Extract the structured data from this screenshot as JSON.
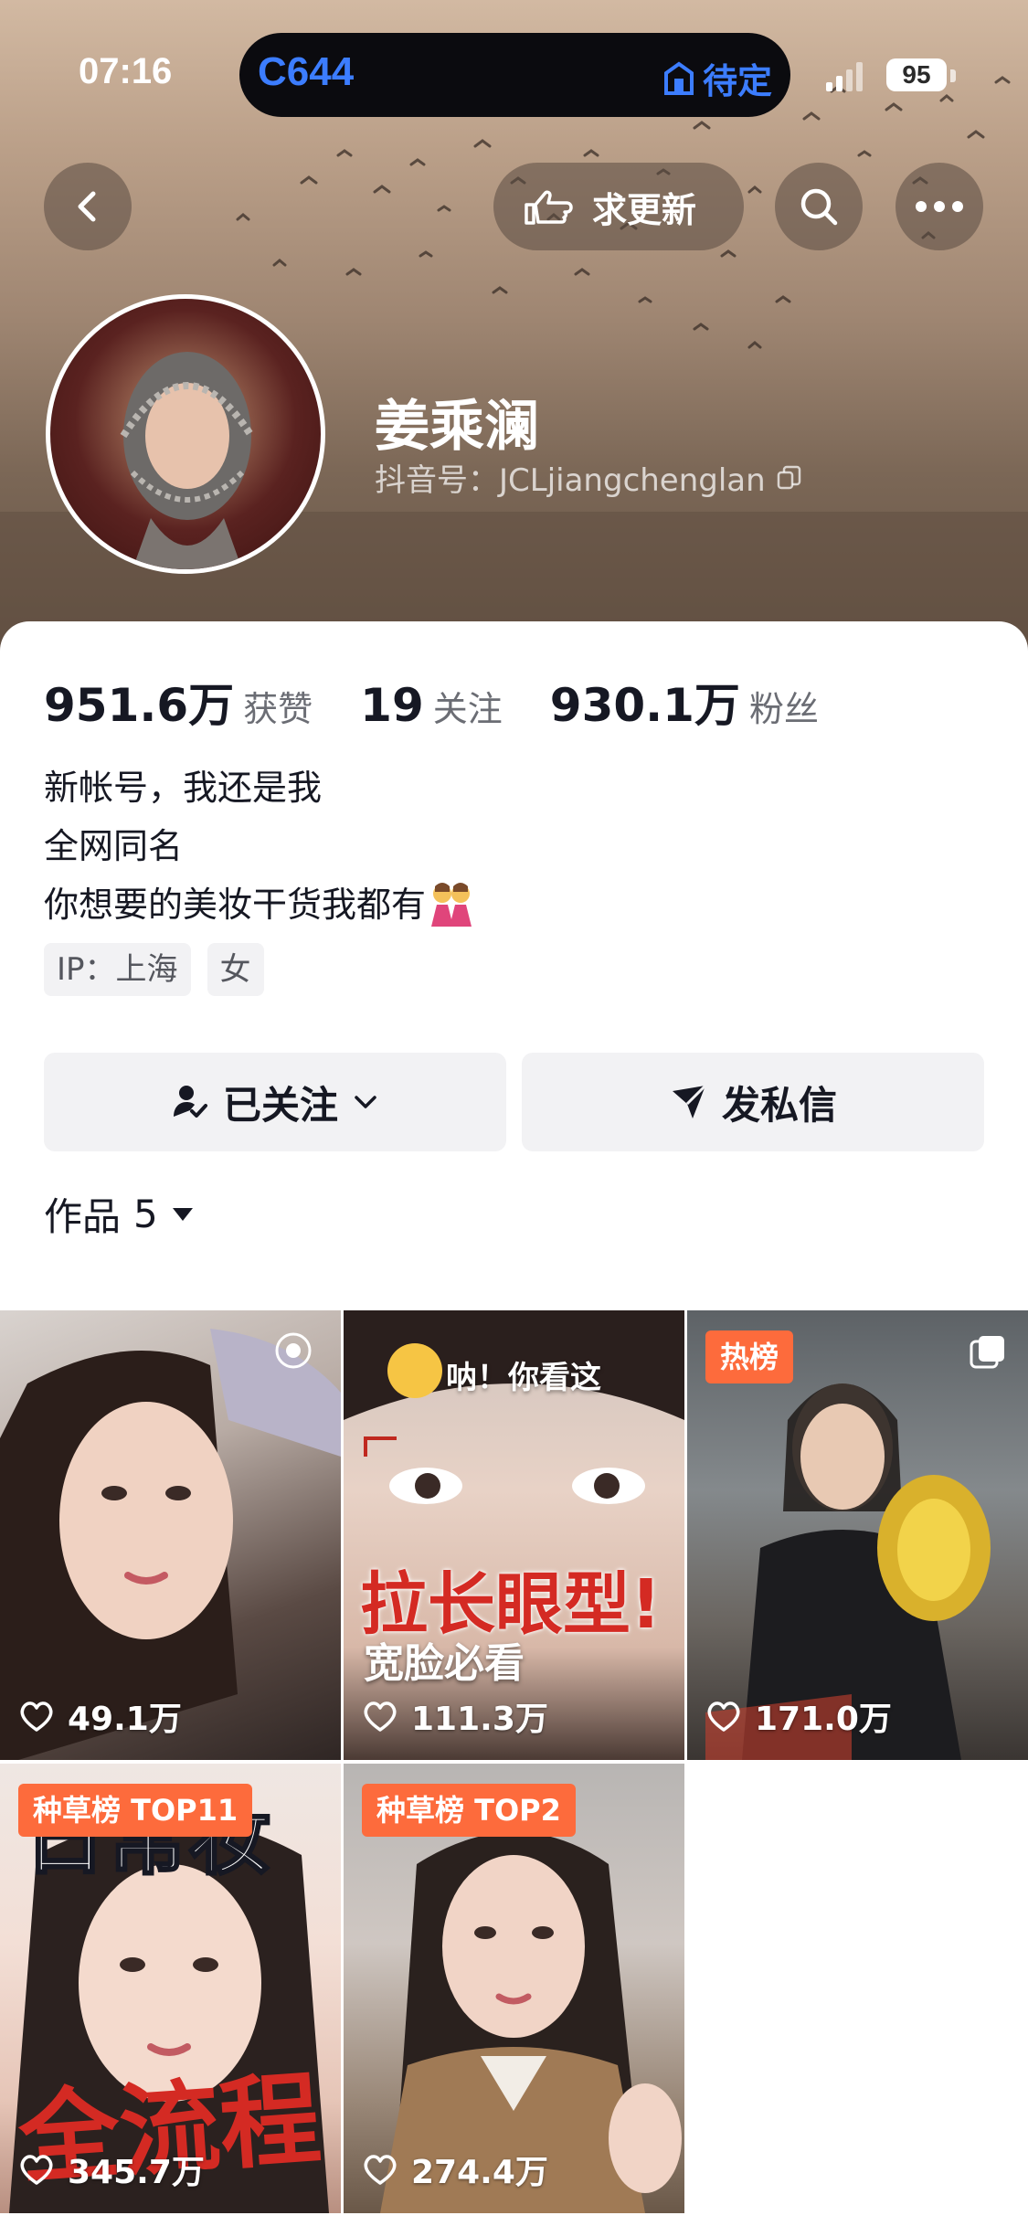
{
  "status_bar": {
    "time": "07:16",
    "island_code": "C644",
    "island_status": "待定",
    "battery": "95"
  },
  "nav": {
    "back_icon": "chevron-left-icon",
    "request_update_label": "求更新",
    "search_icon": "search-icon",
    "more_icon": "more-icon"
  },
  "profile": {
    "name": "姜乘澜",
    "douyin_id": "抖音号：JCLjiangchenglan"
  },
  "stats": [
    {
      "value": "951.6万",
      "label": "获赞"
    },
    {
      "value": "19",
      "label": "关注"
    },
    {
      "value": "930.1万",
      "label": "粉丝"
    }
  ],
  "bio": {
    "line1": "新帐号，我还是我",
    "line2": "全网同名",
    "line3": "你想要的美妆干货我都有",
    "emoji": "👯‍♀️"
  },
  "tags": {
    "ip": "IP：上海",
    "gender": "女"
  },
  "actions": {
    "followed_label": "已关注",
    "message_label": "发私信"
  },
  "works": {
    "label": "作品",
    "count": "5"
  },
  "videos": [
    {
      "likes": "49.1万"
    },
    {
      "likes": "111.3万",
      "overlay_top": "呐！你看这",
      "overlay_main": "拉长眼型!",
      "overlay_sub": "宽脸必看"
    },
    {
      "likes": "171.0万",
      "badge": "热榜"
    },
    {
      "likes": "345.7万",
      "badge": "种草榜 TOP11",
      "overlay_top": "日常妆",
      "overlay_main": "全流程"
    },
    {
      "likes": "274.4万",
      "badge": "种草榜 TOP2"
    }
  ],
  "colors": {
    "accent_blue": "#3c7dff",
    "badge_orange": "#fd6b3c",
    "button_gray": "#f2f2f4"
  }
}
